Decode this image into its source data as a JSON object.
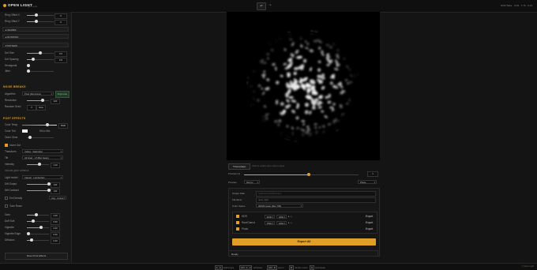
{
  "app": {
    "title": "OPEN LIGHT",
    "version": "gen tools"
  },
  "toolbar": {
    "undo_label": "↶",
    "redo_label": "↷",
    "status": "SVM Tailor · 9.09 · 7.76 · 9.13"
  },
  "sidebar": {
    "rows_top": [
      {
        "label": "Ring Offset X",
        "value": "0"
      },
      {
        "label": "Ring Offset Y",
        "value": "0"
      }
    ],
    "subsections": {
      "shapes": "SHAPES",
      "rotation": "ROTATION",
      "pattern": "PATTERN"
    },
    "pattern_rows": [
      {
        "label": "Dot Size",
        "value": "0.5"
      },
      {
        "label": "Dot Spacing",
        "value": "0.8"
      },
      {
        "label": "Hexagonal",
        "value": ""
      },
      {
        "label": "Jitter",
        "value": "0"
      }
    ],
    "noise": {
      "title": "NOISE BREAKS",
      "algorithm_label": "Algorithm",
      "algorithm_value": "Pixel (Recursive)",
      "badge": "Regenerate",
      "resolution_label": "Resolution",
      "resolution_value": "320",
      "random_label": "Random Seed",
      "random_value": "0",
      "random_btn": "New"
    },
    "post": {
      "title": "POST EFFECTS",
      "rows1": [
        {
          "label": "Color Temp",
          "value": "6500"
        },
        {
          "label": "Color Tint",
          "value": "Hi/Lo Mix"
        },
        {
          "label": "Outer Glow",
          "value": ""
        }
      ],
      "invert_label": "Invert Out",
      "transform_label": "Transform",
      "transform_value": "Yellow · Saturation",
      "tilt_label": "Tilt",
      "tilt_value": "All Grad · 1.5 Blur Heavy",
      "intensity_label": "Intensity",
      "intensity_value": "1.00",
      "extra_note": "Include glow variance",
      "light_model_label": "Light model",
      "light_model_value": "Classic · Lambertian",
      "rows2": [
        {
          "label": "Diff Output",
          "value": "100"
        },
        {
          "label": "Diff Contrast",
          "value": "100"
        }
      ],
      "ext_density_label": "Ext Density",
      "ext_density_value": "Avg · Colour",
      "tone_label": "Tone Rows",
      "rows3": [
        {
          "label": "Gain",
          "value": "1.00"
        },
        {
          "label": "Duff Soft",
          "value": "0.50"
        },
        {
          "label": "Vignette",
          "value": "2.00"
        },
        {
          "label": "Vignette Edge",
          "value": "0.00"
        },
        {
          "label": "Diffusion",
          "value": "0.20"
        }
      ],
      "reset_button": "Reset Post Effects"
    }
  },
  "preview": {
    "autofill_label": "⟲ Autoshape",
    "hint": "Click to enable auto select output",
    "preview_label": "Preview (1)",
    "preview_value": "1",
    "preview_res_label": "Preview",
    "preview_res_value": "512 px",
    "mode_value": "Photo"
  },
  "export": {
    "output_path_label": "Output Path",
    "output_path_placeholder": "/path/to/output/directory",
    "filename_label": "Filename",
    "filename_value": "open_light",
    "color_space_label": "Color Space",
    "color_space_value": "sRGB Linear (Rec.709)",
    "formats": [
      {
        "name": "HDR",
        "format": "EXR",
        "depth": "32bit",
        "checked": true,
        "action": "Export"
      },
      {
        "name": "Raw/Gamut",
        "format": "PNG",
        "depth": "16bit",
        "checked": true,
        "action": "Export"
      },
      {
        "name": "Photo",
        "format": "JPG",
        "depth": "8bit",
        "checked": true,
        "action": "Export"
      }
    ],
    "export_all": "Export All",
    "ready": "Ready"
  },
  "bottom": {
    "hints": [
      {
        "key": "1 · 2",
        "text": "switch type"
      },
      {
        "key": "Ctrl · 1 · 2",
        "text": "variations"
      },
      {
        "key": "Ctrl · S",
        "text": "export"
      },
      {
        "key": "R",
        "text": "random seed"
      },
      {
        "key": "A",
        "text": "autoshape"
      }
    ],
    "right": "© Open Light"
  },
  "colors": {
    "accent": "#e0a028",
    "bg": "#141414",
    "panel": "#181818"
  }
}
